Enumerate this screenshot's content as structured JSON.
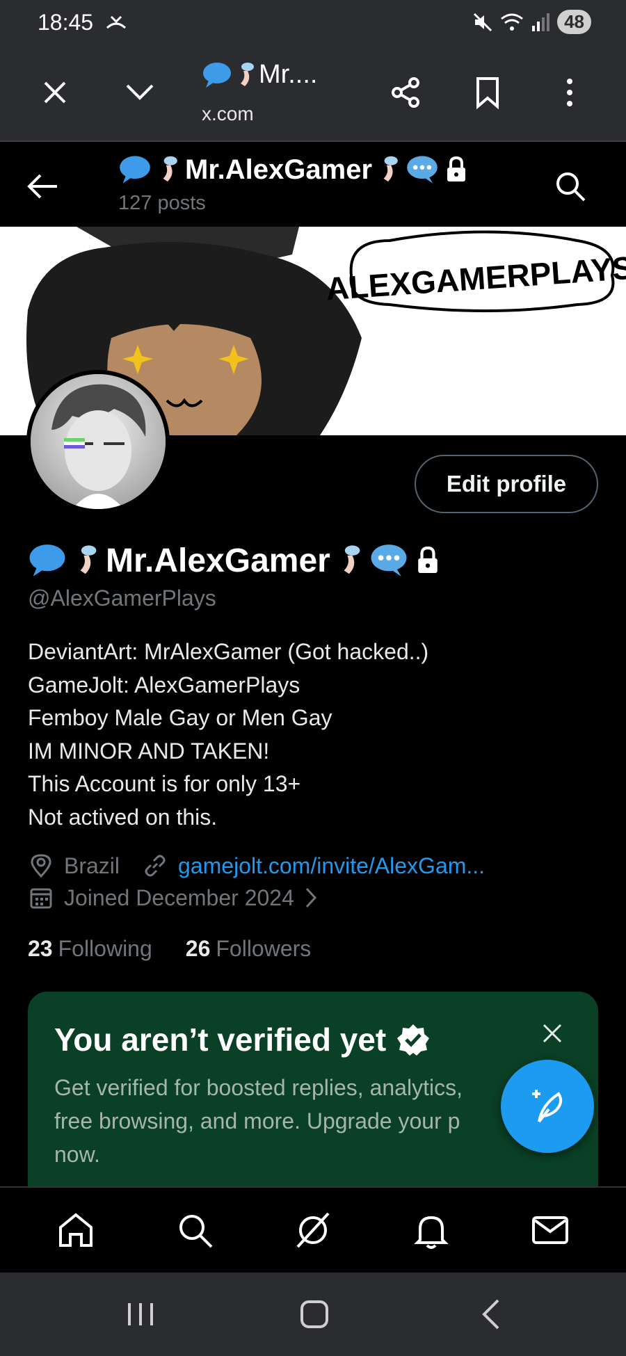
{
  "status_bar": {
    "time": "18:45",
    "battery": "48"
  },
  "browser": {
    "tab_title": "Mr....",
    "url": "x.com"
  },
  "profile_header": {
    "name": "Mr.AlexGamer",
    "post_count": "127 posts"
  },
  "banner": {
    "bubble_text": "ALEXGAMERPLAYS"
  },
  "profile": {
    "edit_label": "Edit profile",
    "name": "Mr.AlexGamer",
    "handle": "@AlexGamerPlays",
    "bio": [
      "DeviantArt: MrAlexGamer (Got hacked..)",
      "GameJolt: AlexGamerPlays",
      "Femboy Male Gay or Men Gay",
      "IM MINOR AND TAKEN!",
      "This Account is for only 13+",
      "Not actived on this."
    ],
    "location": "Brazil",
    "link": "gamejolt.com/invite/AlexGam...",
    "joined": "Joined December 2024",
    "following_count": "23",
    "following_label": "Following",
    "followers_count": "26",
    "followers_label": "Followers"
  },
  "verify_card": {
    "title": "You aren’t verified yet",
    "body": [
      "Get verified for boosted replies, analytics,",
      "free browsing, and more. Upgrade your p",
      "now."
    ]
  },
  "bottom_nav": [
    "home-icon",
    "search-icon",
    "grok-icon",
    "notifications-icon",
    "messages-icon"
  ],
  "colors": {
    "accent": "#1d9bf0",
    "card_bg": "#0a4025",
    "muted": "#71767b"
  }
}
